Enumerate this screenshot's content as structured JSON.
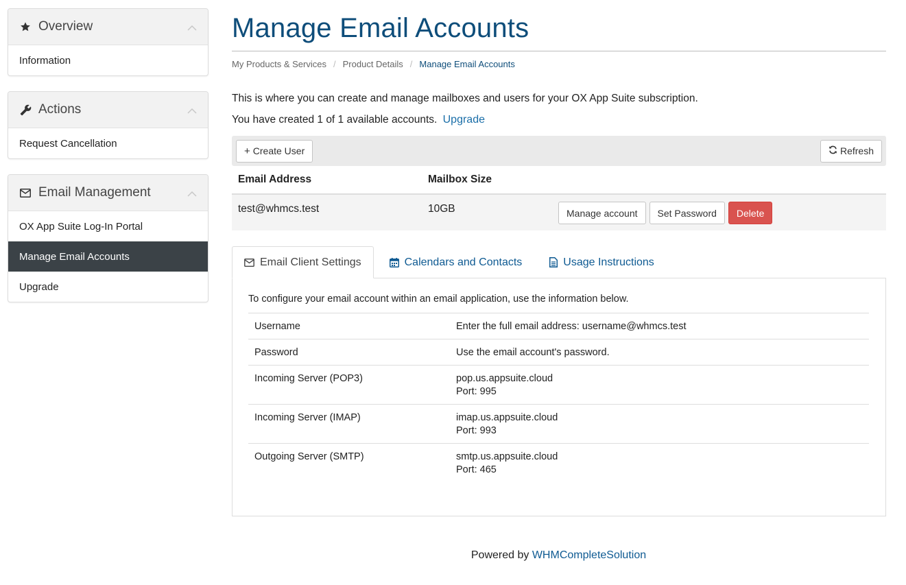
{
  "sidebar": {
    "panels": [
      {
        "title": "Overview",
        "icon": "star-icon",
        "items": [
          {
            "label": "Information",
            "active": false
          }
        ]
      },
      {
        "title": "Actions",
        "icon": "wrench-icon",
        "items": [
          {
            "label": "Request Cancellation",
            "active": false
          }
        ]
      },
      {
        "title": "Email Management",
        "icon": "envelope-icon",
        "items": [
          {
            "label": "OX App Suite Log-In Portal",
            "active": false
          },
          {
            "label": "Manage Email Accounts",
            "active": true
          },
          {
            "label": "Upgrade",
            "active": false
          }
        ]
      }
    ]
  },
  "page": {
    "title": "Manage Email Accounts",
    "breadcrumb": [
      "My Products & Services",
      "Product Details",
      "Manage Email Accounts"
    ],
    "intro": "This is where you can create and manage mailboxes and users for your OX App Suite subscription.",
    "quota_text": "You have created 1 of 1 available accounts.",
    "upgrade_link": "Upgrade"
  },
  "toolbar": {
    "create_label": "Create User",
    "refresh_label": "Refresh"
  },
  "accounts": {
    "headers": {
      "email": "Email Address",
      "size": "Mailbox Size"
    },
    "rows": [
      {
        "email": "test@whmcs.test",
        "size": "10GB"
      }
    ],
    "actions": {
      "manage": "Manage account",
      "password": "Set Password",
      "delete": "Delete"
    }
  },
  "tabs": [
    {
      "label": "Email Client Settings",
      "icon": "envelope-icon"
    },
    {
      "label": "Calendars and Contacts",
      "icon": "calendar-icon"
    },
    {
      "label": "Usage Instructions",
      "icon": "document-icon"
    }
  ],
  "settings": {
    "intro": "To configure your email account within an email application, use the information below.",
    "rows": [
      {
        "label": "Username",
        "line1": "Enter the full email address: username@whmcs.test",
        "line2": ""
      },
      {
        "label": "Password",
        "line1": "Use the email account's password.",
        "line2": ""
      },
      {
        "label": "Incoming Server (POP3)",
        "line1": "pop.us.appsuite.cloud",
        "line2": "Port: 995"
      },
      {
        "label": "Incoming Server (IMAP)",
        "line1": "imap.us.appsuite.cloud",
        "line2": "Port: 993"
      },
      {
        "label": "Outgoing Server (SMTP)",
        "line1": "smtp.us.appsuite.cloud",
        "line2": "Port: 465"
      }
    ]
  },
  "footer": {
    "prefix": "Powered by",
    "link": "WHMCompleteSolution"
  },
  "colors": {
    "accent": "#0e4d7a",
    "danger": "#d9534f",
    "active_nav": "#3b4247"
  }
}
